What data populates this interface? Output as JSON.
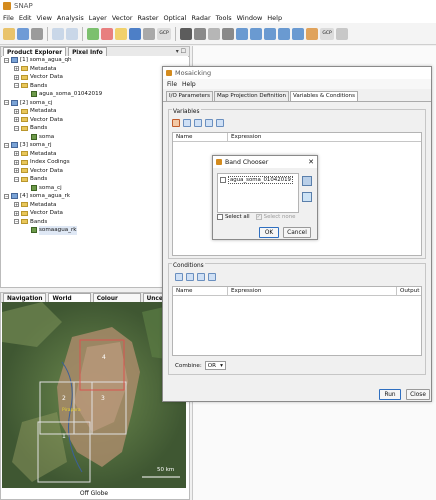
{
  "app": {
    "title": "SNAP"
  },
  "menu": [
    "File",
    "Edit",
    "View",
    "Analysis",
    "Layer",
    "Vector",
    "Raster",
    "Optical",
    "Radar",
    "Tools",
    "Window",
    "Help"
  ],
  "toolbar": {
    "gcp_label_1": "GCP",
    "gcp_label_2": "GCP"
  },
  "left_panel": {
    "tabs": [
      "Product Explorer",
      "Pixel Info"
    ],
    "tree": [
      {
        "level": 0,
        "type": "prod",
        "label": "[1] soma_agua_qh"
      },
      {
        "level": 1,
        "type": "fold",
        "label": "Metadata"
      },
      {
        "level": 1,
        "type": "fold",
        "label": "Vector Data"
      },
      {
        "level": 1,
        "type": "fold",
        "label": "Bands"
      },
      {
        "level": 2,
        "type": "band",
        "label": "agua_soma_01042019"
      },
      {
        "level": 0,
        "type": "prod",
        "label": "[2] soma_cj"
      },
      {
        "level": 1,
        "type": "fold",
        "label": "Metadata"
      },
      {
        "level": 1,
        "type": "fold",
        "label": "Vector Data"
      },
      {
        "level": 1,
        "type": "fold",
        "label": "Bands"
      },
      {
        "level": 2,
        "type": "band",
        "label": "soma"
      },
      {
        "level": 0,
        "type": "prod",
        "label": "[3] soma_rj"
      },
      {
        "level": 1,
        "type": "fold",
        "label": "Metadata"
      },
      {
        "level": 1,
        "type": "fold",
        "label": "Index Codings"
      },
      {
        "level": 1,
        "type": "fold",
        "label": "Vector Data"
      },
      {
        "level": 1,
        "type": "fold",
        "label": "Bands"
      },
      {
        "level": 2,
        "type": "band",
        "label": "soma_cj"
      },
      {
        "level": 0,
        "type": "prod",
        "label": "[4] soma_agua_rk"
      },
      {
        "level": 1,
        "type": "fold",
        "label": "Metadata"
      },
      {
        "level": 1,
        "type": "fold",
        "label": "Vector Data"
      },
      {
        "level": 1,
        "type": "fold",
        "label": "Bands"
      },
      {
        "level": 2,
        "type": "band",
        "label": "somaagua_rk"
      }
    ]
  },
  "nav_panel": {
    "tabs": [
      "Navigation",
      "World View",
      "Colour Manie",
      "Uncertainty"
    ],
    "map_footer": "Off Globe",
    "scale": "50 km",
    "footprints": [
      "1",
      "2",
      "3",
      "4"
    ],
    "yellow_label": "Pirapora"
  },
  "mosaic": {
    "title": "Mosaicking",
    "menu": [
      "File",
      "Help"
    ],
    "tabs": [
      "I/O Parameters",
      "Map Projection Definition",
      "Variables & Conditions"
    ],
    "variables_label": "Variables",
    "var_cols": [
      "Name",
      "Expression"
    ],
    "conditions_label": "Conditions",
    "cond_cols": [
      "Name",
      "Expression",
      "Output"
    ],
    "combine_label": "Combine:",
    "combine_value": "OR",
    "run": "Run",
    "close": "Close"
  },
  "annotation": {
    "text": "3",
    "color": "#cc1111"
  },
  "band_chooser": {
    "title": "Band Chooser",
    "item": "agua_soma_01042019",
    "select_all": "Select all",
    "select_none": "Select none",
    "ok": "OK",
    "cancel": "Cancel"
  }
}
